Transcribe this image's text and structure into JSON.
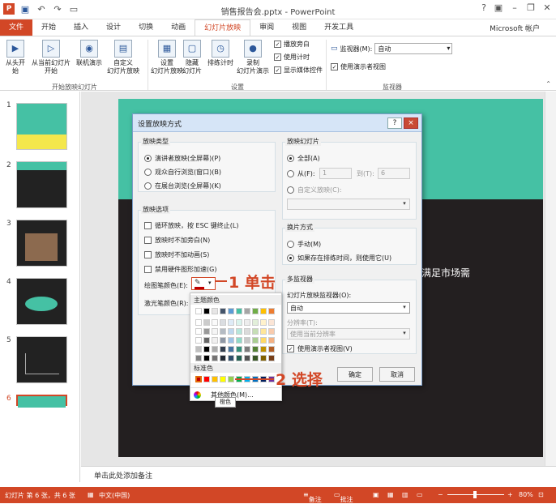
{
  "window": {
    "title": "销售报告会.pptx - PowerPoint"
  },
  "tabs": [
    "文件",
    "开始",
    "插入",
    "设计",
    "切换",
    "动画",
    "幻灯片放映",
    "审阅",
    "视图",
    "开发工具"
  ],
  "active_tab": "幻灯片放映",
  "account": "Microsoft 帐户",
  "ribbon": {
    "start_group": {
      "btn1": "从头开始",
      "btn2a": "从当前幻灯片",
      "btn2b": "开始",
      "btn3": "联机演示",
      "btn4a": "自定义",
      "btn4b": "幻灯片放映",
      "label": "开始放映幻灯片"
    },
    "setup_group": {
      "btn1a": "设置",
      "btn1b": "幻灯片放映",
      "btn2a": "隐藏",
      "btn2b": "幻灯片",
      "btn3": "排练计时",
      "btn4a": "录制",
      "btn4b": "幻灯片演示",
      "chk1": "播放旁白",
      "chk2": "使用计时",
      "chk3": "显示媒体控件",
      "label": "设置"
    },
    "monitor_group": {
      "monitor_label": "监视器(M):",
      "monitor_value": "自动",
      "presenter": "使用演示者视图",
      "label": "监视器"
    }
  },
  "slides": [
    "1",
    "2",
    "3",
    "4",
    "5",
    "6"
  ],
  "slide_text": "满足市场需",
  "notes": "单击此处添加备注",
  "status": {
    "slide": "幻灯片 第 6 张，共 6 张",
    "lang": "中文(中国)",
    "notes_btn": "备注",
    "comments_btn": "批注",
    "zoom": "80%"
  },
  "dialog": {
    "title": "设置放映方式",
    "help": "?",
    "close": "×",
    "show_type": {
      "label": "放映类型",
      "opt1": "演讲者放映(全屏幕)(P)",
      "opt2": "观众自行浏览(窗口)(B)",
      "opt3": "在展台浏览(全屏幕)(K)"
    },
    "show_options": {
      "label": "放映选项",
      "opt1": "循环放映，按 ESC 键终止(L)",
      "opt2": "放映时不加旁白(N)",
      "opt3": "放映时不加动画(S)",
      "opt4": "禁用硬件图形加速(G)",
      "pen_color": "绘图笔颜色(E):",
      "laser_color": "激光笔颜色(R):"
    },
    "show_slides": {
      "label": "放映幻灯片",
      "all": "全部(A)",
      "from": "从(F):",
      "from_value": "1",
      "to": "到(T):",
      "to_value": "6",
      "custom": "自定义放映(C):"
    },
    "advance": {
      "label": "换片方式",
      "manual": "手动(M)",
      "timings": "如果存在排练时间，则使用它(U)"
    },
    "multi_monitor": {
      "label": "多监视器",
      "monitor_label": "幻灯片放映监视器(O):",
      "monitor_value": "自动",
      "resolution_label": "分辨率(T):",
      "resolution_value": "使用当前分辨率",
      "presenter": "使用演示者视图(V)"
    },
    "ok": "确定",
    "cancel": "取消"
  },
  "color_popup": {
    "theme": "主题颜色",
    "standard": "标准色",
    "more": "其他颜色(M)...",
    "tooltip": "橙色"
  },
  "callouts": {
    "step1": "1 单击",
    "step2": "2 选择"
  },
  "theme_colors": [
    "#ffffff",
    "#000000",
    "#e7e6e6",
    "#44546a",
    "#5b9bd5",
    "#45c1a4",
    "#a5a5a5",
    "#70ad47",
    "#ffc000",
    "#ed7d31"
  ],
  "standard_colors": [
    "#c00000",
    "#ff0000",
    "#ffc000",
    "#ffff00",
    "#92d050",
    "#00b050",
    "#00b0f0",
    "#0070c0",
    "#002060",
    "#7030a0"
  ]
}
